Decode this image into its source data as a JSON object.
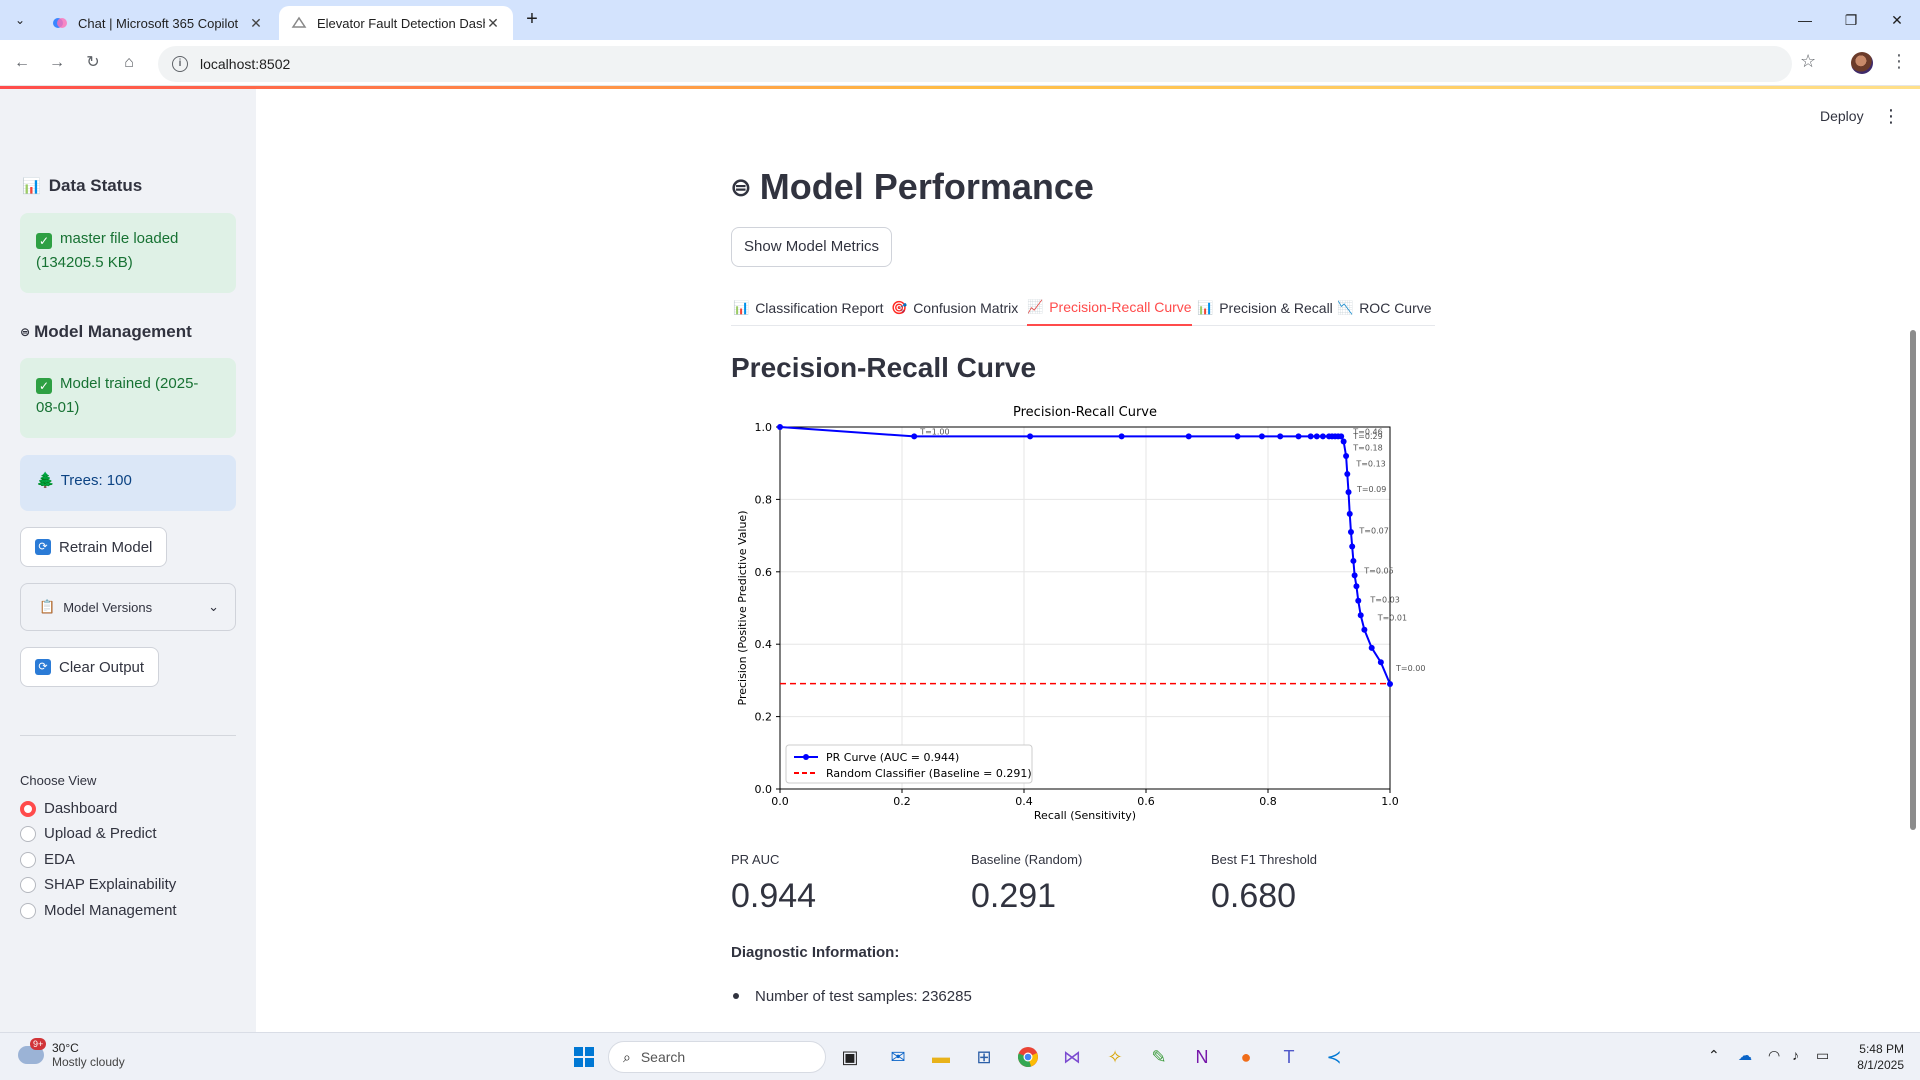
{
  "browser": {
    "tabs": [
      {
        "title": "Chat | Microsoft 365 Copilot",
        "active": false
      },
      {
        "title": "Elevator Fault Detection Dashbo",
        "active": true
      }
    ],
    "url": "localhost:8502"
  },
  "sidebar": {
    "data_status": {
      "heading": "Data Status",
      "message": "master file loaded (134205.5 KB)"
    },
    "model_management": {
      "heading": "Model Management",
      "trained": "Model trained (2025-08-01)",
      "trees": "Trees: 100",
      "retrain_label": "Retrain Model",
      "versions_label": "Model Versions",
      "clear_label": "Clear Output"
    },
    "choose_view": {
      "label": "Choose View",
      "options": [
        "Dashboard",
        "Upload & Predict",
        "EDA",
        "SHAP Explainability",
        "Model Management"
      ],
      "selected": "Dashboard"
    }
  },
  "header": {
    "deploy_label": "Deploy"
  },
  "main": {
    "title": "Model Performance",
    "metrics_button": "Show Model Metrics",
    "tabs": [
      {
        "label": "Classification Report",
        "icon": "bar-chart-icon"
      },
      {
        "label": "Confusion Matrix",
        "icon": "target-icon"
      },
      {
        "label": "Precision-Recall Curve",
        "icon": "line-chart-icon"
      },
      {
        "label": "Precision & Recall",
        "icon": "bar-chart-icon"
      },
      {
        "label": "ROC Curve",
        "icon": "down-chart-icon"
      }
    ],
    "active_tab": "Precision-Recall Curve",
    "section_title": "Precision-Recall Curve",
    "metrics": [
      {
        "label": "PR AUC",
        "value": "0.944"
      },
      {
        "label": "Baseline (Random)",
        "value": "0.291"
      },
      {
        "label": "Best F1 Threshold",
        "value": "0.680"
      }
    ],
    "diagnostic_title": "Diagnostic Information:",
    "diagnostic_items": [
      "Number of test samples: 236285"
    ]
  },
  "chart_data": {
    "type": "line",
    "title": "Precision-Recall Curve",
    "xlabel": "Recall (Sensitivity)",
    "ylabel": "Precision (Positive Predictive Value)",
    "xlim": [
      0.0,
      1.0
    ],
    "ylim": [
      0.0,
      1.0
    ],
    "xticks": [
      "0.0",
      "0.2",
      "0.4",
      "0.6",
      "0.8",
      "1.0"
    ],
    "yticks": [
      "0.0",
      "0.2",
      "0.4",
      "0.6",
      "0.8",
      "1.0"
    ],
    "grid": true,
    "legend_position": "lower-left",
    "series": [
      {
        "name": "PR Curve (AUC = 0.944)",
        "color": "#0000ff",
        "style": "solid-with-markers",
        "x": [
          0.0,
          0.22,
          0.41,
          0.56,
          0.67,
          0.75,
          0.79,
          0.82,
          0.85,
          0.87,
          0.88,
          0.89,
          0.9,
          0.905,
          0.91,
          0.915,
          0.92,
          0.924,
          0.928,
          0.93,
          0.932,
          0.934,
          0.936,
          0.938,
          0.94,
          0.942,
          0.945,
          0.948,
          0.952,
          0.958,
          0.97,
          0.985,
          1.0
        ],
        "y": [
          1.0,
          0.974,
          0.974,
          0.974,
          0.974,
          0.974,
          0.974,
          0.974,
          0.974,
          0.974,
          0.974,
          0.974,
          0.974,
          0.974,
          0.974,
          0.974,
          0.974,
          0.96,
          0.92,
          0.87,
          0.82,
          0.76,
          0.71,
          0.67,
          0.63,
          0.59,
          0.56,
          0.52,
          0.48,
          0.44,
          0.39,
          0.35,
          0.29
        ]
      },
      {
        "name": "Random Classifier (Baseline = 0.291)",
        "color": "#ff0000",
        "style": "dashed",
        "x": [
          0.0,
          1.0
        ],
        "y": [
          0.291,
          0.291
        ]
      }
    ],
    "annotations": [
      {
        "text": "T=1.00",
        "x": 0.22,
        "y": 0.974
      },
      {
        "text": "T=0.46",
        "x": 0.93,
        "y": 0.974
      },
      {
        "text": "T=0.29",
        "x": 0.93,
        "y": 0.962
      },
      {
        "text": "T=0.18",
        "x": 0.93,
        "y": 0.93
      },
      {
        "text": "T=0.13",
        "x": 0.935,
        "y": 0.885
      },
      {
        "text": "T=0.09",
        "x": 0.936,
        "y": 0.815
      },
      {
        "text": "T=0.07",
        "x": 0.94,
        "y": 0.7
      },
      {
        "text": "T=0.05",
        "x": 0.948,
        "y": 0.59
      },
      {
        "text": "T=0.03",
        "x": 0.958,
        "y": 0.51
      },
      {
        "text": "T=0.01",
        "x": 0.97,
        "y": 0.46
      },
      {
        "text": "T=0.00",
        "x": 1.0,
        "y": 0.32
      }
    ]
  },
  "taskbar": {
    "weather": {
      "temp": "30°C",
      "desc": "Mostly cloudy",
      "badge": "9+"
    },
    "search_placeholder": "Search",
    "time": "5:48 PM",
    "date": "8/1/2025"
  }
}
